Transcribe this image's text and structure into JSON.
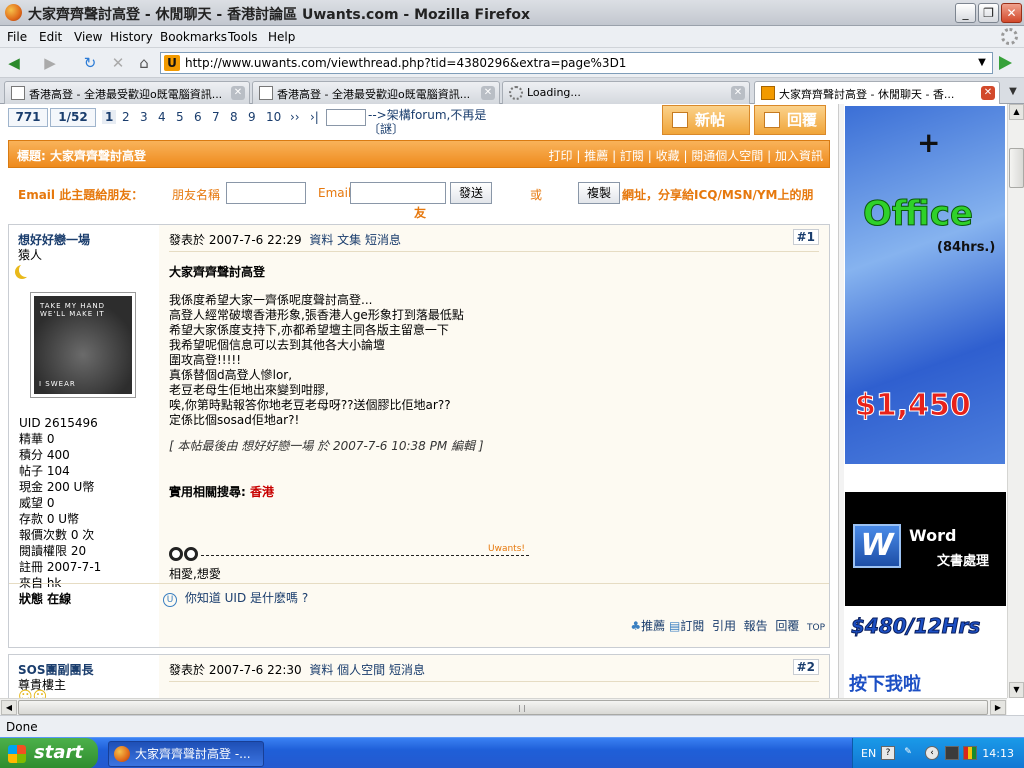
{
  "window": {
    "title": "大家齊齊聲討高登 - 休閒聊天 - 香港討論區 Uwants.com - Mozilla Firefox"
  },
  "menu": [
    "File",
    "Edit",
    "View",
    "History",
    "Bookmarks",
    "Tools",
    "Help"
  ],
  "address": {
    "url": "http://www.uwants.com/viewthread.php?tid=4380296&extra=page%3D1"
  },
  "tabs": [
    {
      "label": "香港高登 - 全港最受歡迎o既電腦資訊...",
      "icon": "page",
      "active": false
    },
    {
      "label": "香港高登 - 全港最受歡迎o既電腦資訊...",
      "icon": "page",
      "active": false
    },
    {
      "label": "Loading...",
      "icon": "loading",
      "active": false
    },
    {
      "label": "大家齊齊聲討高登 - 休閒聊天 - 香...",
      "icon": "uwants",
      "active": true
    }
  ],
  "pager": {
    "total": "771",
    "position": "1/52",
    "pages": [
      "1",
      "2",
      "3",
      "4",
      "5",
      "6",
      "7",
      "8",
      "9",
      "10"
    ],
    "next": "››",
    "last": "›|",
    "link_text": "-->架構forum,不再是〔謎〕"
  },
  "actions": {
    "new_post": "新帖",
    "reply": "回覆"
  },
  "thread": {
    "subject_label": "標題:",
    "subject": "大家齊齊聲討高登",
    "links": [
      "打印",
      "推薦",
      "訂閱",
      "收藏",
      "閱通個人空間",
      "加入資訊"
    ]
  },
  "email_share": {
    "label": "Email 此主題給朋友：",
    "friend_name_label": "朋友名稱",
    "email_label": "Email",
    "send_button": "發送",
    "or": "或",
    "copy_button": "複製",
    "share_text_1": "網址，分享給ICQ/MSN/YM上的朋",
    "share_text_2": "友"
  },
  "post1": {
    "author": "想好好戀一場",
    "rank": "猿人",
    "avatar_caption_top": "TAKE MY HAND  WE'LL MAKE IT",
    "avatar_caption_bottom": "I SWEAR",
    "stats": [
      "UID 2615496",
      "精華 0",
      "積分 400",
      "帖子 104",
      "現金 200 U幣",
      "威望 0",
      "存款 0 U幣",
      "報價次數 0 次",
      "閱讀權限 20",
      "註冊 2007-7-1",
      "來自 hk",
      "狀態 在線"
    ],
    "posted": "發表於 2007-7-6 22:29",
    "head_links": [
      "資料",
      "文集",
      "短消息"
    ],
    "number": "#1",
    "title": "大家齊齊聲討高登",
    "body": [
      "我係度希望大家一齊係呢度聲討高登...",
      "高登人經常破壞香港形象,張香港人ge形象打到落最低點",
      "希望大家係度支持下,亦都希望壇主同各版主留意一下",
      "我希望呢個信息可以去到其他各大小論壇",
      "圍攻高登!!!!!",
      "真係替個d高登人慘lor,",
      "老豆老母生佢地出來變到咁膠,",
      "唉,你第時點報答你地老豆老母呀??送個膠比佢地ar??",
      "定係比個sosad佢地ar?!"
    ],
    "edited": "[ 本帖最後由 想好好戀一場 於 2007-7-6 10:38 PM 編輯 ]",
    "related_label": "實用相關搜尋:",
    "related_keyword": "香港",
    "sig_brand": "Uwants!",
    "signature": "相愛,想愛",
    "tip": "你知道 UID 是什麽嗎 ?",
    "footer_links": [
      "推薦",
      "訂閱",
      "引用",
      "報告",
      "回覆"
    ]
  },
  "post2": {
    "author": "SOS團副團長",
    "rank": "尊貴樓主",
    "posted": "發表於 2007-7-6 22:30",
    "head_links": [
      "資料",
      "個人空間",
      "短消息"
    ],
    "number": "#2"
  },
  "ads": {
    "ad1_plus": "+",
    "ad1_product": "Office",
    "ad1_hours": "(84hrs.)",
    "ad1_price": "$1,450",
    "ad2_product": "Word",
    "ad2_sub": "文書處理",
    "ad2_price": "$480/12Hrs",
    "ad3_text": "按下我啦"
  },
  "status": {
    "text": "Done"
  },
  "taskbar": {
    "start": "start",
    "item": "大家齊齊聲討高登 -...",
    "lang": "EN",
    "clock": "14:13"
  }
}
